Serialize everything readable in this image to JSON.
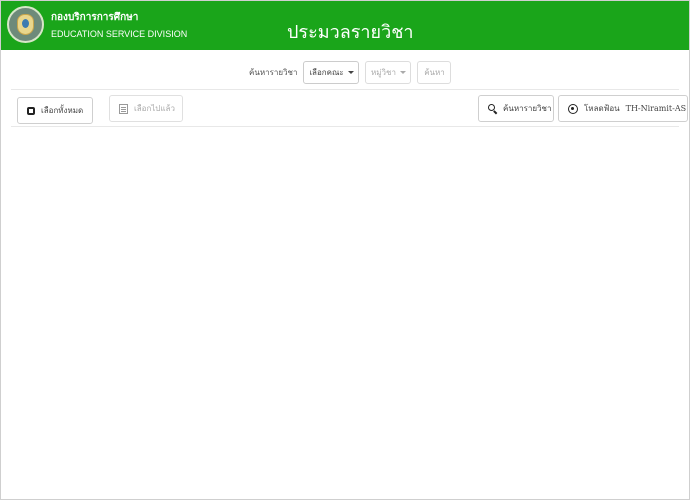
{
  "header": {
    "org_name_thai": "กองบริการการศึกษา",
    "org_name_english": "EDUCATION SERVICE DIVISION",
    "page_title": "ประมวลรายวิชา",
    "bar_color": "#1aa51a",
    "logo_icon": "university-emblem-icon"
  },
  "search_bar": {
    "label": "ค้นหารายวิชา",
    "faculty_dropdown": "เลือกคณะ",
    "group_dropdown": "หมู่วิชา",
    "search_button": "ค้นหา"
  },
  "actions": {
    "select_all": {
      "label": "เลือกทั้งหมด",
      "icon": "checkbox-square-icon"
    },
    "selected": {
      "label": "เลือกไปแล้ว",
      "icon": "list-icon"
    },
    "search_course": {
      "label": "ค้นหารายวิชา",
      "icon": "search-icon"
    },
    "download_font": {
      "label": "โหลดฟ้อน",
      "font_name": "TH-Niramit-AS",
      "icon": "download-circle-icon"
    }
  }
}
